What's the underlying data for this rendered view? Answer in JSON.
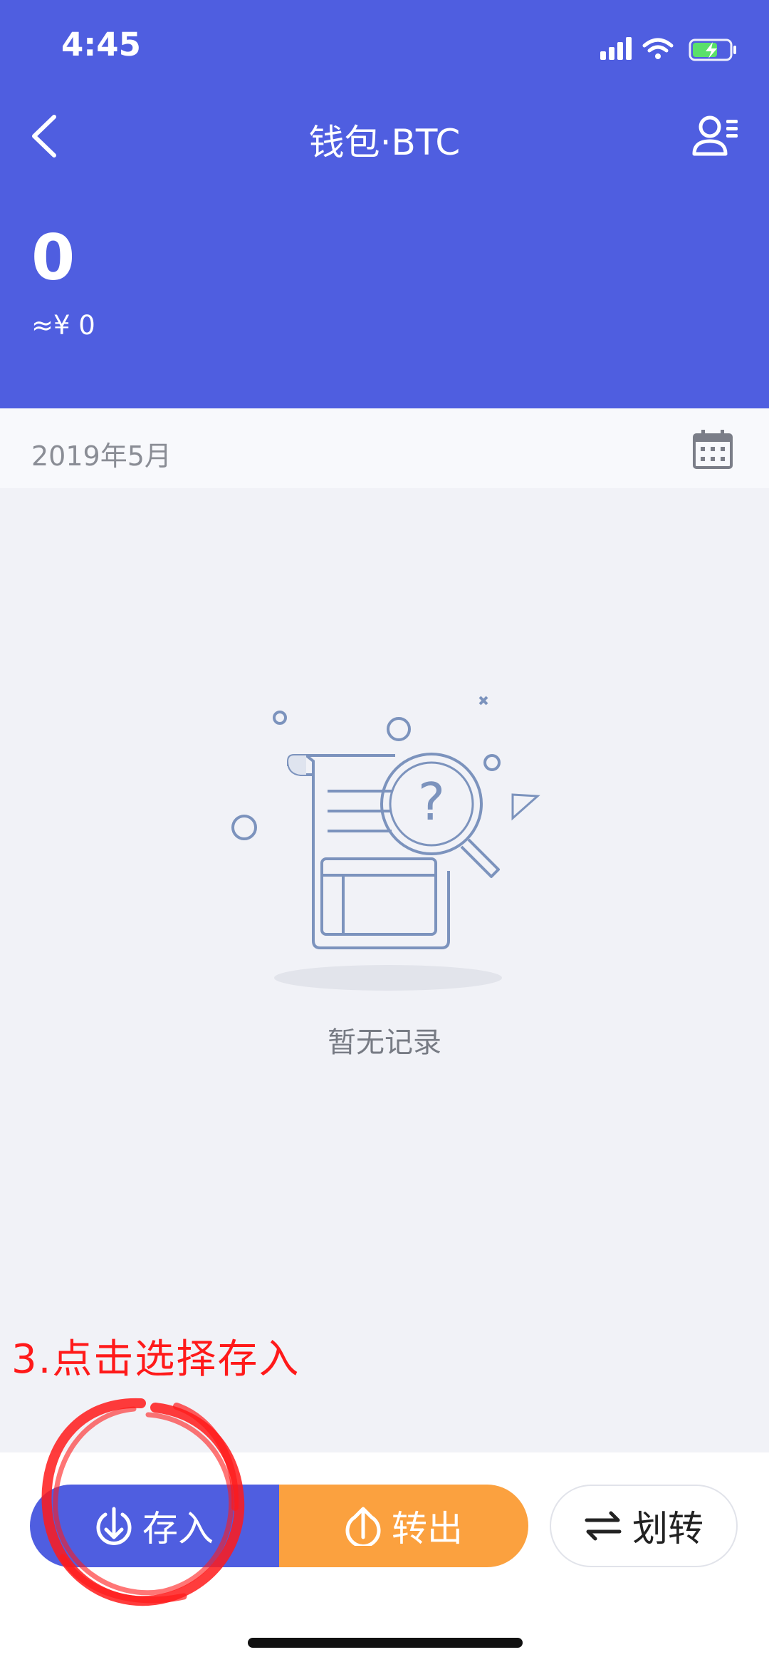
{
  "status_bar": {
    "time": "4:45"
  },
  "nav": {
    "title": "钱包·BTC"
  },
  "balance": {
    "amount": "0",
    "cny": "≈¥ 0"
  },
  "month_bar": {
    "label": "2019年5月"
  },
  "empty_state": {
    "text": "暂无记录"
  },
  "annotation": {
    "text": "3.点击选择存入"
  },
  "actions": {
    "deposit": "存入",
    "withdraw": "转出",
    "transfer": "划转"
  },
  "colors": {
    "brand": "#4f5ee0",
    "withdraw": "#fba13f",
    "annotation": "#ff1a1a"
  },
  "icons": [
    "back-arrow-icon",
    "account-list-icon",
    "calendar-icon",
    "signal-icon",
    "wifi-icon",
    "battery-charging-icon",
    "download-icon",
    "upload-icon",
    "swap-arrows-icon"
  ]
}
